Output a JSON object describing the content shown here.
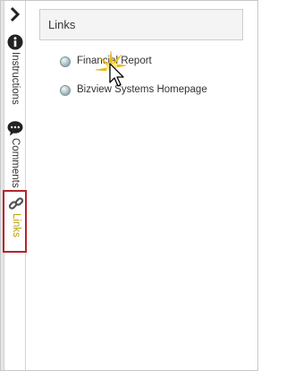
{
  "rail": {
    "tabs": [
      {
        "label": "Instructions",
        "icon": "info-icon"
      },
      {
        "label": "Comments",
        "icon": "comment-icon"
      },
      {
        "label": "Links",
        "icon": "link-icon",
        "active": true
      }
    ],
    "active_color": "#b8a200",
    "active_border": "#b3262e"
  },
  "panel": {
    "title": "Links",
    "links": [
      {
        "label": "Financial Report"
      },
      {
        "label": "Bizview Systems Homepage"
      }
    ]
  }
}
